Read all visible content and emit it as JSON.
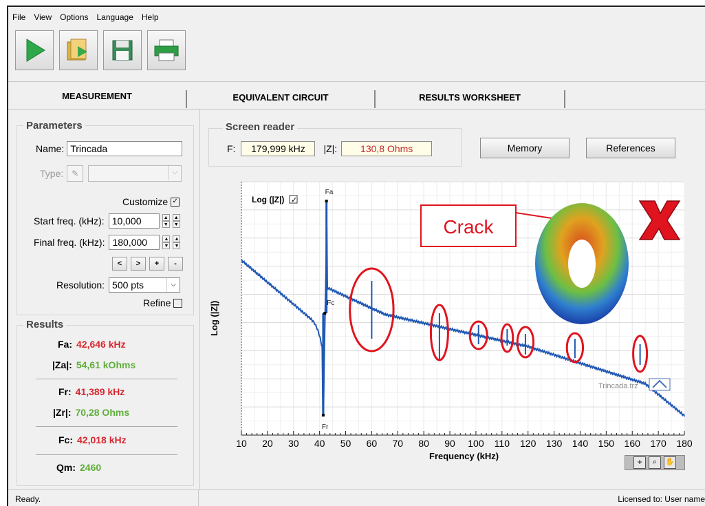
{
  "menu": [
    "File",
    "View",
    "Options",
    "Language",
    "Help"
  ],
  "toolbar": {
    "icons": [
      "run-icon",
      "open-folder-icon",
      "save-icon",
      "print-icon"
    ]
  },
  "tabs": [
    "MEASUREMENT",
    "EQUIVALENT CIRCUIT",
    "RESULTS WORKSHEET"
  ],
  "parameters": {
    "legend": "Parameters",
    "name_label": "Name:",
    "name_value": "Trincada",
    "type_label": "Type:",
    "customize_label": "Customize",
    "start_label": "Start freq. (kHz):",
    "start_value": "10,000",
    "final_label": "Final freq. (kHz):",
    "final_value": "180,000",
    "btn_lt": "<",
    "btn_gt": ">",
    "btn_plus": "+",
    "btn_minus": "-",
    "resolution_label": "Resolution:",
    "resolution_value": "500 pts",
    "refine_label": "Refine"
  },
  "results": {
    "legend": "Results",
    "fa_label": "Fa:",
    "fa_value": "42,646 kHz",
    "za_label": "|Za|:",
    "za_value": "54,61 kOhms",
    "fr_label": "Fr:",
    "fr_value": "41,389 kHz",
    "zr_label": "|Zr|:",
    "zr_value": "70,28 Ohms",
    "fc_label": "Fc:",
    "fc_value": "42,018 kHz",
    "qm_label": "Qm:",
    "qm_value": "2460"
  },
  "screen_reader": {
    "legend": "Screen reader",
    "f_label": "F:",
    "f_value": "179,999 kHz",
    "z_label": "|Z|:",
    "z_value": "130,8 Ohms"
  },
  "buttons": {
    "memory": "Memory",
    "references": "References"
  },
  "plot": {
    "log_label": "Log (|Z|)",
    "ylabel": "Log (|Z|)",
    "xlabel": "Frequency (kHz)",
    "marker_fa": "Fa",
    "marker_fc": "Fc",
    "marker_fr": "Fr",
    "crack_label": "Crack",
    "file_label": "Trincada.trz",
    "x_ticks": [
      10,
      20,
      30,
      40,
      50,
      60,
      70,
      80,
      90,
      100,
      110,
      120,
      130,
      140,
      150,
      160,
      170,
      180
    ],
    "xlim": [
      10,
      180
    ],
    "fa_khz": 42.646,
    "fc_khz": 42.018,
    "fr_khz": 41.389,
    "circled_khz": [
      60,
      86,
      101,
      112,
      119,
      138,
      163
    ]
  },
  "status": {
    "left": "Ready.",
    "right": "Licensed to: User name"
  },
  "colors": {
    "curve": "#1f58b4",
    "highlight": "#e0141e",
    "value_red": "#d6272f",
    "value_green": "#5fae3a"
  }
}
